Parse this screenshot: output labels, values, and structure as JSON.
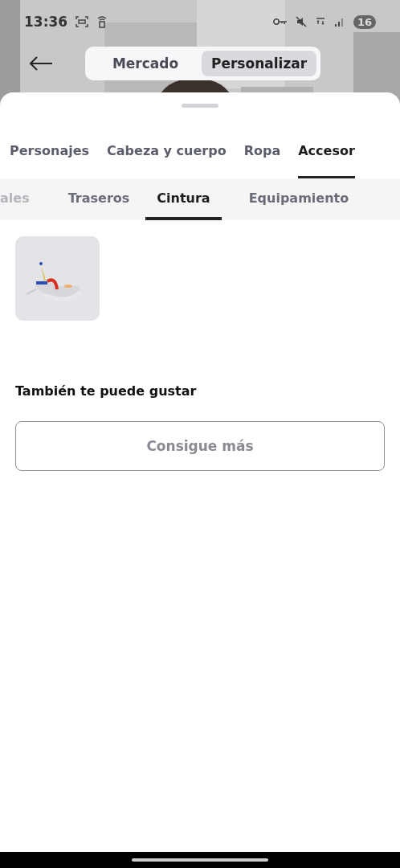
{
  "status_bar": {
    "time": "13:36",
    "battery": "16"
  },
  "header": {
    "segments": [
      {
        "label": "Mercado",
        "selected": false
      },
      {
        "label": "Personalizar",
        "selected": true
      }
    ]
  },
  "category_tabs": [
    {
      "label": "Personajes",
      "selected": false
    },
    {
      "label": "Cabeza y cuerpo",
      "selected": false
    },
    {
      "label": "Ropa",
      "selected": false
    },
    {
      "label": "Accesor",
      "selected": true
    }
  ],
  "subcategory_tabs": [
    {
      "label": "ales",
      "selected": false
    },
    {
      "label": "Traseros",
      "selected": false
    },
    {
      "label": "Cintura",
      "selected": true
    },
    {
      "label": "Equipamiento",
      "selected": false
    }
  ],
  "recommendations": {
    "title": "También te puede gustar",
    "button": "Consigue más"
  }
}
